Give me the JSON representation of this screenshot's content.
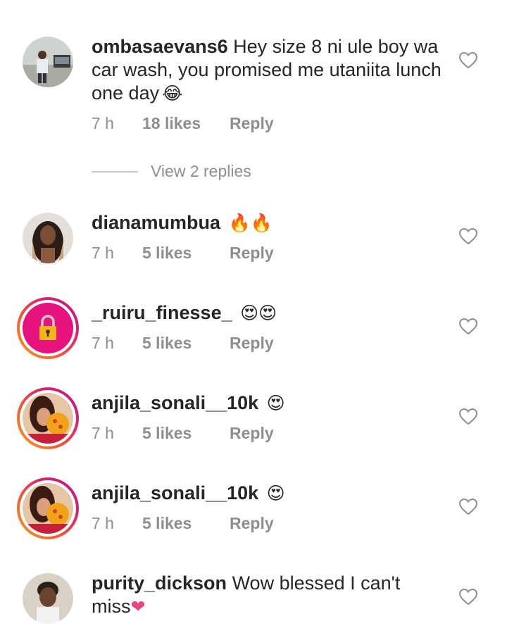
{
  "comments": [
    {
      "username": "ombasaevans6",
      "text": "Hey size 8 ni ule boy wa car wash, you promised me utaniita lunch one day",
      "emoji": "😂",
      "time": "7 h",
      "likes": "18 likes",
      "reply": "Reply"
    },
    {
      "username": "dianamumbua",
      "text": "",
      "emoji": "🔥🔥",
      "time": "7 h",
      "likes": "5 likes",
      "reply": "Reply"
    },
    {
      "username": "_ruiru_finesse_",
      "text": "",
      "emoji": "😍😍",
      "time": "7 h",
      "likes": "5 likes",
      "reply": "Reply"
    },
    {
      "username": "anjila_sonali__10k",
      "text": "",
      "emoji": "😍",
      "time": "7 h",
      "likes": "5 likes",
      "reply": "Reply"
    },
    {
      "username": "anjila_sonali__10k",
      "text": "",
      "emoji": "😍",
      "time": "7 h",
      "likes": "5 likes",
      "reply": "Reply"
    },
    {
      "username": "purity_dickson",
      "text": "Wow blessed I can't miss",
      "emoji": "❤",
      "time": "",
      "likes": "",
      "reply": ""
    }
  ],
  "view_replies": "View 2 replies",
  "icons": {
    "like": "heart-outline-icon",
    "lock": "lock-icon"
  },
  "colors": {
    "text": "#262626",
    "meta": "#8e8e8e",
    "lock_bg": "#e6127e",
    "lock_gold": "#f3b71a"
  }
}
